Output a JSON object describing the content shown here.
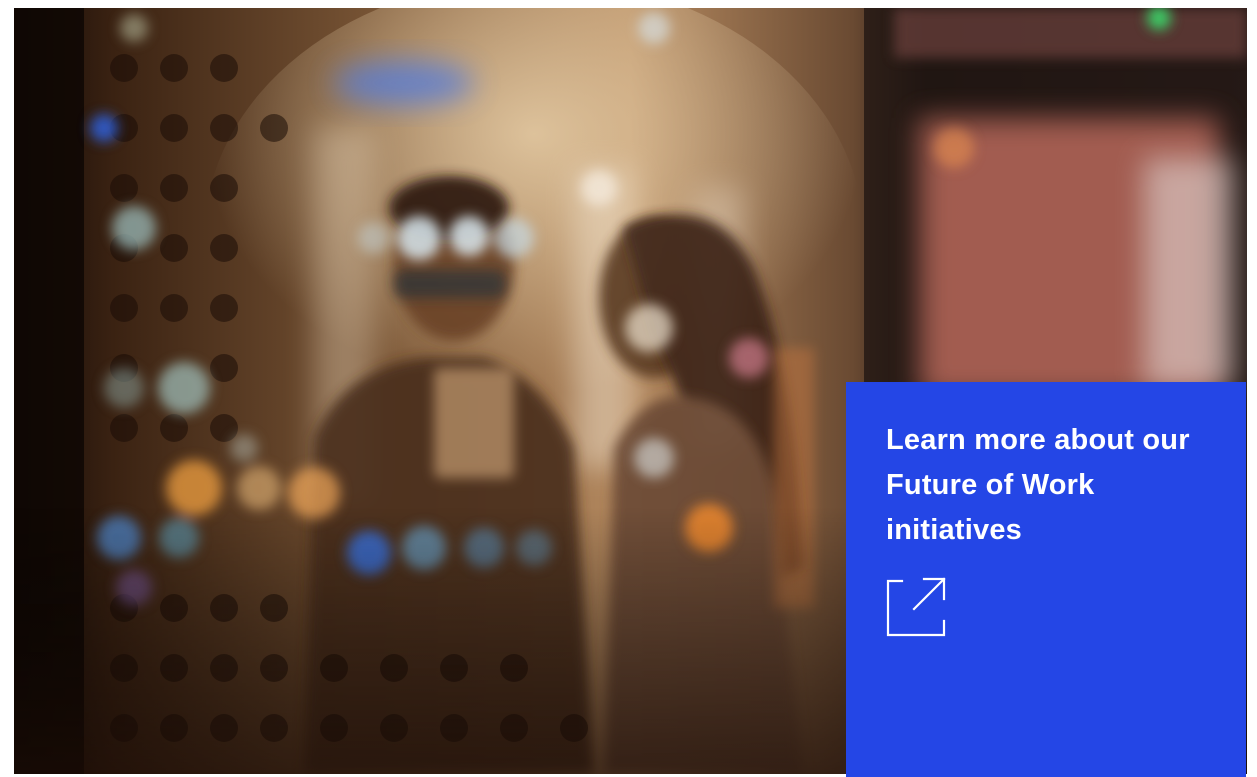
{
  "promo": {
    "text": "Learn more about our Future of Work initiatives",
    "icon": "external-link-icon",
    "background_color": "#2446e6",
    "text_color": "#ffffff"
  },
  "hero": {
    "image": "office-people-night-bokeh-photo"
  }
}
